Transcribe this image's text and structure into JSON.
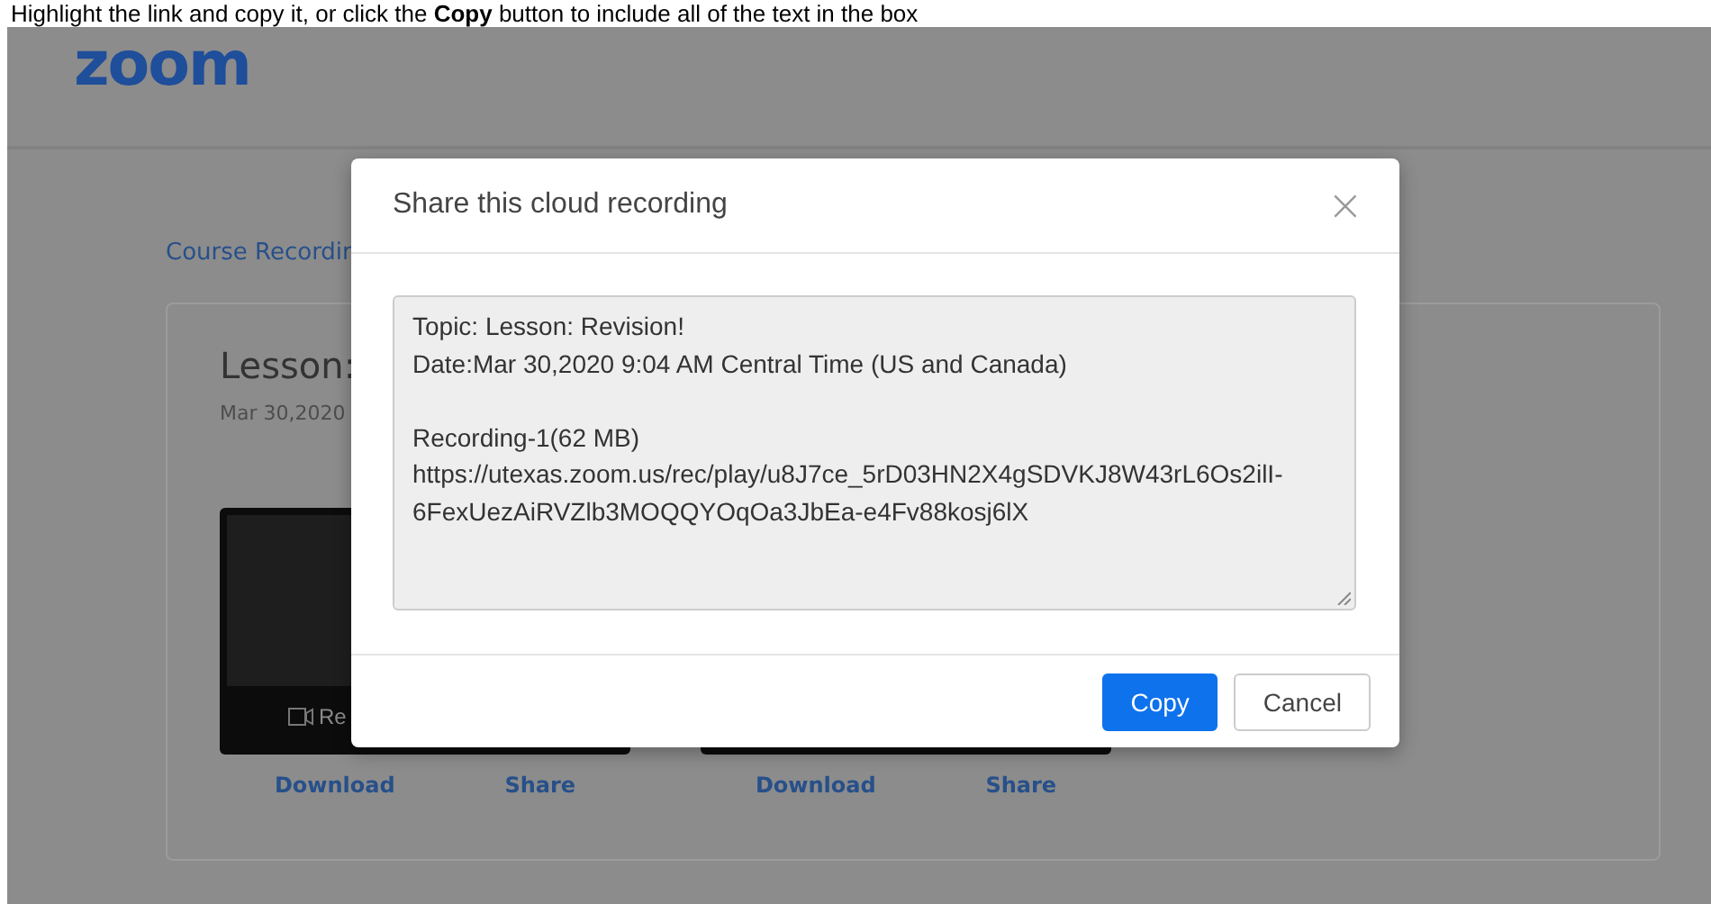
{
  "caption": "Highlight the link and copy it, or click the **Copy** button to include all of the text in the box",
  "header": {
    "logo": "zoom"
  },
  "breadcrumb": "Course Recordin",
  "card": {
    "title": "Lesson:",
    "date": "Mar 30,2020",
    "recordings": [
      {
        "label": "Re",
        "links": [
          "Download",
          "Share"
        ]
      },
      {
        "links": [
          "Download",
          "Share"
        ]
      }
    ]
  },
  "dialog": {
    "title": "Share this cloud recording",
    "close": "×",
    "share_text": {
      "value": "Topic: Lesson: Revision!\nDate:Mar 30,2020 9:04 AM Central Time (US and Canada)\n\nRecording-1(62 MB)\nhttps://utexas.zoom.us/rec/play/u8J7ce_5rD03HN2X4gSDVKJ8W43rL6Os2ilI-6FexUezAiRVZlb3MOQQYOqOa3JbEa-e4Fv88kosj6lX"
    },
    "buttons": [
      {
        "label": "Copy",
        "kind": "primary"
      },
      {
        "label": "Cancel",
        "kind": "secondary"
      }
    ]
  }
}
